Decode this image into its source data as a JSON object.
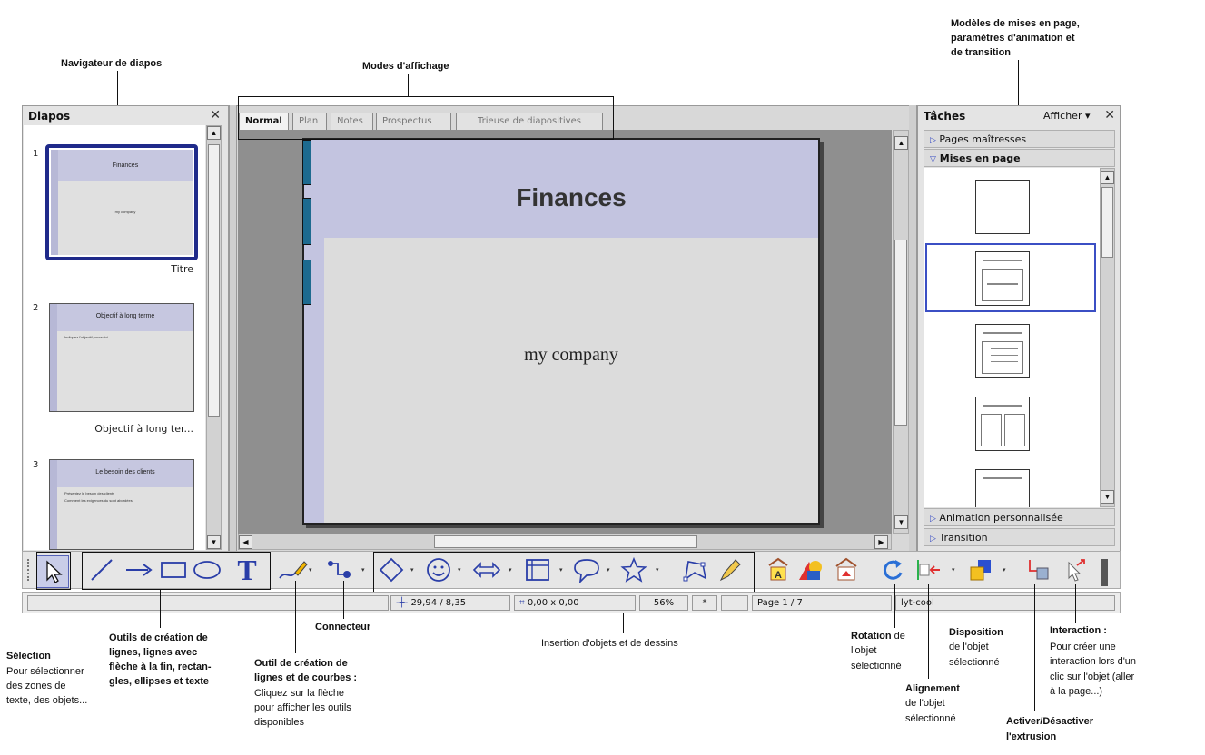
{
  "callouts": {
    "navigator": "Navigateur de diapos",
    "display_modes": "Modes d'affichage",
    "models_1": "Modèles de mises en page,",
    "models_2": "paramètres d'animation et",
    "models_3": "de transition",
    "selection_title": "Sélection",
    "selection_1": "Pour sélectionner",
    "selection_2": "des zones de",
    "selection_3": "texte, des objets...",
    "lines_1": "Outils de création de",
    "lines_2": "lignes, lignes avec",
    "lines_3": "flèche à la fin, rectan-",
    "lines_4": "gles, ellipses et texte",
    "curves_1": "Outil de création de",
    "curves_2": "lignes et de courbes :",
    "curves_3": "Cliquez sur la flèche",
    "curves_4": "pour afficher les outils",
    "curves_5": "disponibles",
    "connector": "Connecteur",
    "insert": "Insertion d'objets et de dessins",
    "rotation_title": "Rotation",
    "rotation_de": " de",
    "rotation_2": "l'objet",
    "rotation_3": "sélectionné",
    "align_title": "Alignement",
    "align_2": "de l'objet",
    "align_3": "sélectionné",
    "dispo_title": "Disposition",
    "dispo_2": "de l'objet",
    "dispo_3": "sélectionné",
    "interaction_title": "Interaction :",
    "interaction_1": "Pour créer une",
    "interaction_2": "interaction lors d'un",
    "interaction_3": "clic sur l'objet (aller",
    "interaction_4": "à la page...)",
    "extrusion_1": "Activer/Désactiver",
    "extrusion_2": "l'extrusion"
  },
  "slides_pane": {
    "title": "Diapos",
    "slides": [
      {
        "number": "1",
        "title": "Finances",
        "subtitle": "my company",
        "label": "Titre"
      },
      {
        "number": "2",
        "title": "Objectif à long terme",
        "bullet": "Indiquez l'objectif poursuivi",
        "label": "Objectif à long ter..."
      },
      {
        "number": "3",
        "title": "Le besoin des clients",
        "bullet1": "Présentez le besoin des clients",
        "bullet2": "Comment les exigences du sont abordées"
      }
    ]
  },
  "tabs": [
    "Normal",
    "Plan",
    "Notes",
    "Prospectus",
    "Trieuse de diapositives"
  ],
  "slide": {
    "title": "Finances",
    "subtitle": "my company"
  },
  "tasks_pane": {
    "title": "Tâches",
    "view_menu": "Afficher",
    "sections": {
      "master_pages": "Pages maîtresses",
      "layouts": "Mises en page",
      "custom_animation": "Animation personnalisée",
      "transition": "Transition"
    }
  },
  "statusbar": {
    "position": "29,94 / 8,35",
    "size": "0,00 x 0,00",
    "zoom": "56%",
    "modified": "*",
    "page": "Page 1 / 7",
    "master": "lyt-cool"
  },
  "colors": {
    "slide_band": "#c3c4e0",
    "accent_blue": "#2a3ea8",
    "highlight": "#3b4fc4"
  }
}
